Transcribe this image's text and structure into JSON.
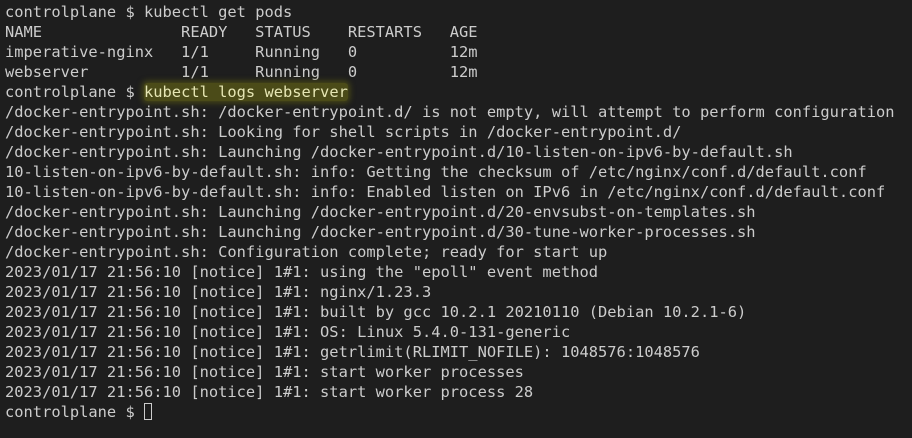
{
  "terminal": {
    "prompt": "controlplane $ ",
    "commands": {
      "get_pods": "kubectl get pods",
      "logs": "kubectl logs webserver"
    },
    "pods_table": {
      "header": "NAME               READY   STATUS    RESTARTS   AGE",
      "rows": [
        "imperative-nginx   1/1     Running   0          12m",
        "webserver          1/1     Running   0          12m"
      ]
    },
    "log_lines": [
      "/docker-entrypoint.sh: /docker-entrypoint.d/ is not empty, will attempt to perform configuration",
      "/docker-entrypoint.sh: Looking for shell scripts in /docker-entrypoint.d/",
      "/docker-entrypoint.sh: Launching /docker-entrypoint.d/10-listen-on-ipv6-by-default.sh",
      "10-listen-on-ipv6-by-default.sh: info: Getting the checksum of /etc/nginx/conf.d/default.conf",
      "10-listen-on-ipv6-by-default.sh: info: Enabled listen on IPv6 in /etc/nginx/conf.d/default.conf",
      "/docker-entrypoint.sh: Launching /docker-entrypoint.d/20-envsubst-on-templates.sh",
      "/docker-entrypoint.sh: Launching /docker-entrypoint.d/30-tune-worker-processes.sh",
      "/docker-entrypoint.sh: Configuration complete; ready for start up",
      "2023/01/17 21:56:10 [notice] 1#1: using the \"epoll\" event method",
      "2023/01/17 21:56:10 [notice] 1#1: nginx/1.23.3",
      "2023/01/17 21:56:10 [notice] 1#1: built by gcc 10.2.1 20210110 (Debian 10.2.1-6)",
      "2023/01/17 21:56:10 [notice] 1#1: OS: Linux 5.4.0-131-generic",
      "2023/01/17 21:56:10 [notice] 1#1: getrlimit(RLIMIT_NOFILE): 1048576:1048576",
      "2023/01/17 21:56:10 [notice] 1#1: start worker processes",
      "2023/01/17 21:56:10 [notice] 1#1: start worker process 28"
    ],
    "colors": {
      "background": "#1e1e1e",
      "text": "#cccccc",
      "highlight": "#4b4b18"
    }
  }
}
